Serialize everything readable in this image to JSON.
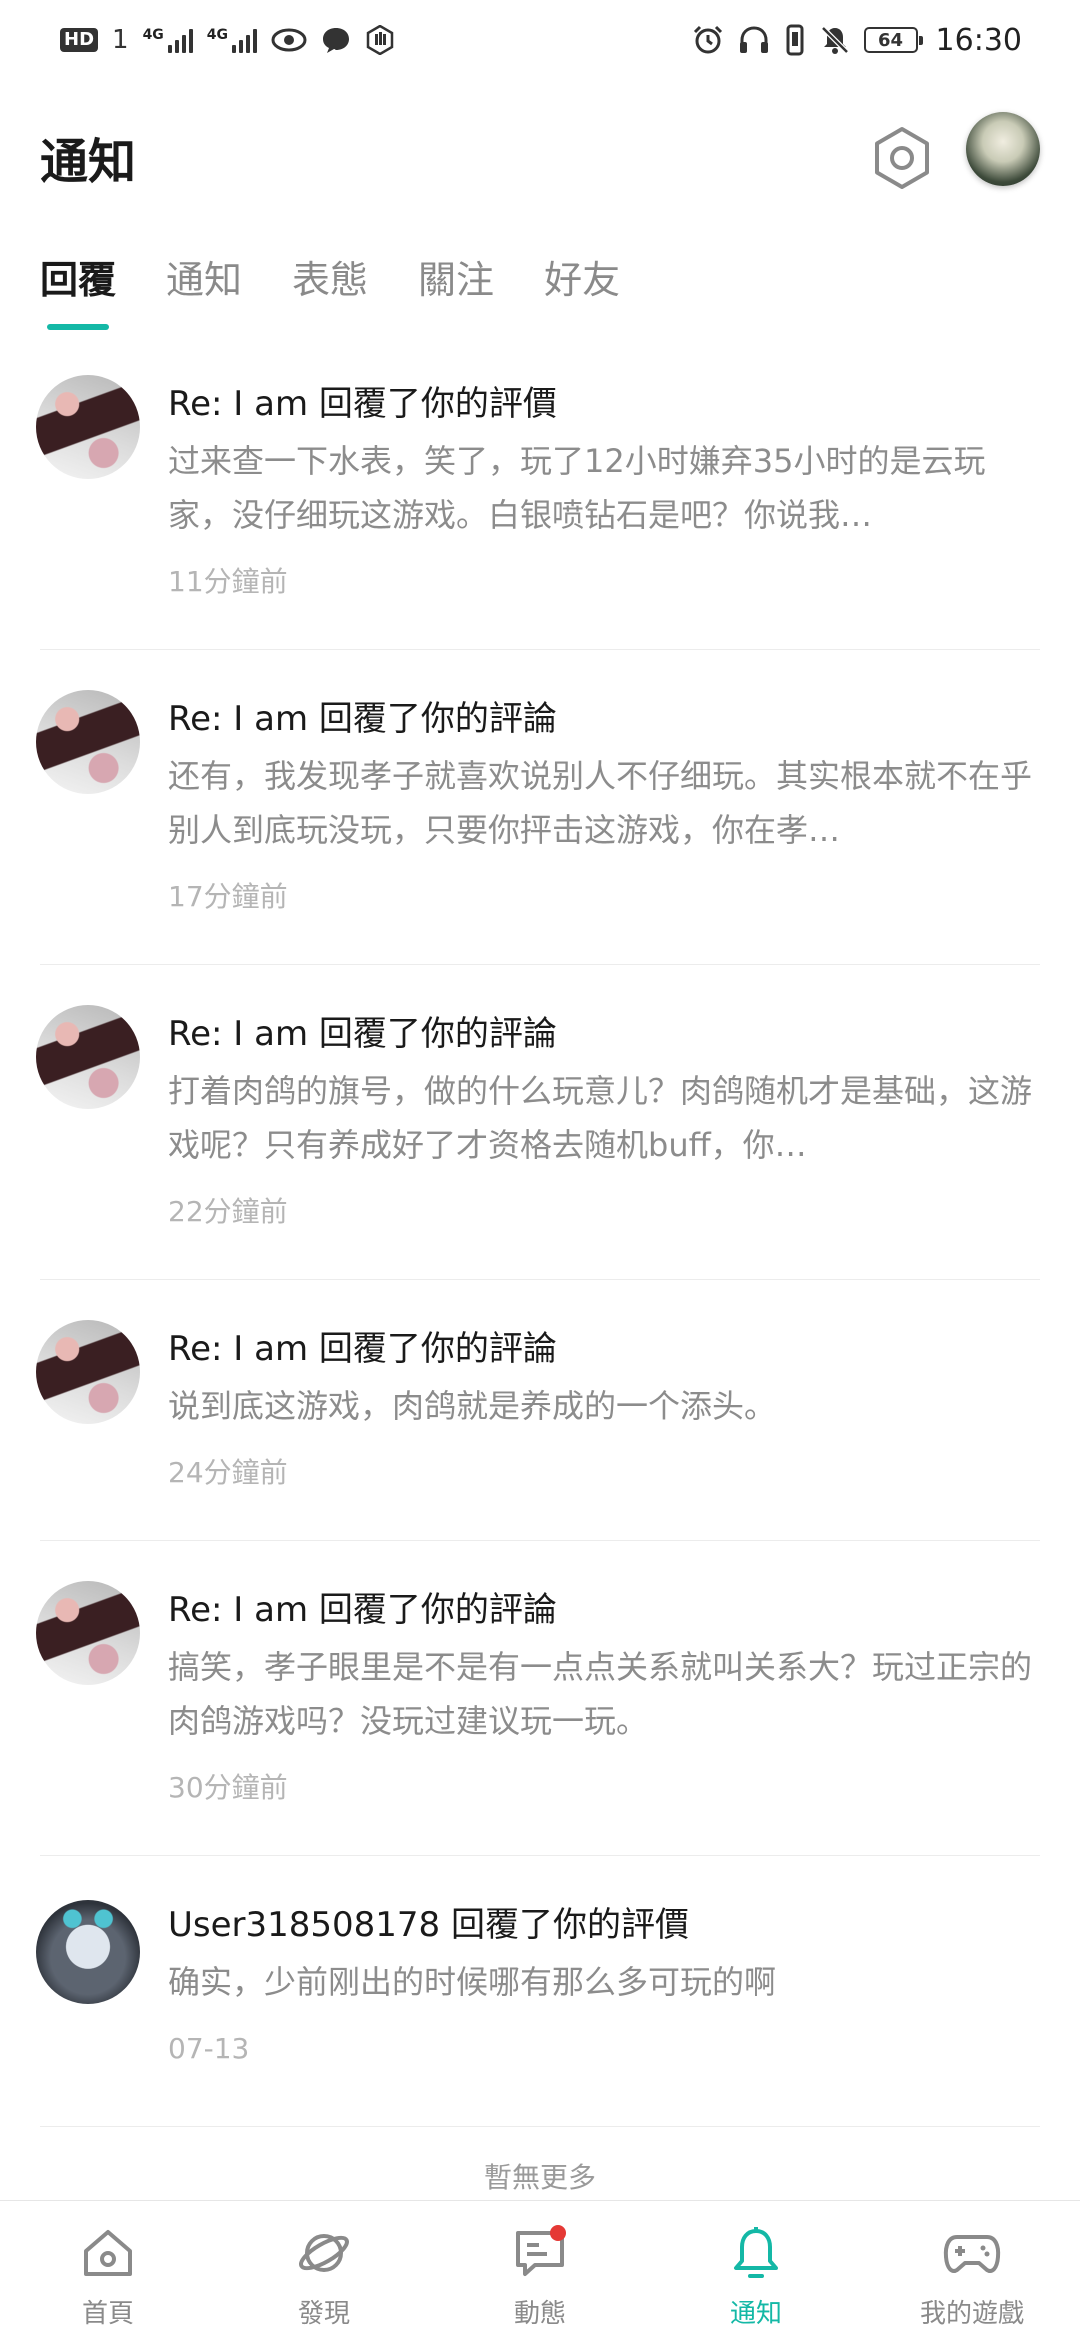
{
  "status_bar": {
    "left_icons": [
      "hd-icon",
      "sim-1-icon",
      "signal-4g-icon",
      "signal-4g-icon",
      "eye-icon",
      "chat-bubble-icon",
      "hand-icon"
    ],
    "right_icons": [
      "alarm-icon",
      "headphones-icon",
      "vibrate-icon",
      "mute-icon"
    ],
    "battery": "64",
    "time": "16:30",
    "labels": {
      "hd": "HD",
      "sim": "1",
      "net": "4G"
    }
  },
  "header": {
    "title": "通知"
  },
  "tabs": [
    {
      "label": "回覆",
      "active": true
    },
    {
      "label": "通知",
      "active": false
    },
    {
      "label": "表態",
      "active": false
    },
    {
      "label": "關注",
      "active": false
    },
    {
      "label": "好友",
      "active": false
    }
  ],
  "notifications": [
    {
      "title": "Re: I am 回覆了你的評價",
      "body": "过来查一下水表，笑了，玩了12小时嫌弃35小时的是云玩家，没仔细玩这游戏。白银喷钻石是吧？你说我…",
      "time": "11分鐘前"
    },
    {
      "title": "Re: I am 回覆了你的評論",
      "body": "还有，我发现孝子就喜欢说别人不仔细玩。其实根本就不在乎别人到底玩没玩，只要你抨击这游戏，你在孝…",
      "time": "17分鐘前"
    },
    {
      "title": "Re: I am 回覆了你的評論",
      "body": "打着肉鸽的旗号，做的什么玩意儿？肉鸽随机才是基础，这游戏呢？只有养成好了才资格去随机buff，你…",
      "time": "22分鐘前"
    },
    {
      "title": "Re: I am 回覆了你的評論",
      "body": "说到底这游戏，肉鸽就是养成的一个添头。",
      "time": "24分鐘前"
    },
    {
      "title": "Re: I am 回覆了你的評論",
      "body": "搞笑，孝子眼里是不是有一点点关系就叫关系大？玩过正宗的肉鸽游戏吗？没玩过建议玩一玩。",
      "time": "30分鐘前"
    },
    {
      "title": "User318508178 回覆了你的評價",
      "body": "确实，少前刚出的时候哪有那么多可玩的啊",
      "time": "07-13"
    }
  ],
  "list_footer": "暫無更多",
  "bottom_nav": [
    {
      "label": "首頁",
      "icon": "home-icon",
      "active": false
    },
    {
      "label": "發現",
      "icon": "planet-icon",
      "active": false
    },
    {
      "label": "動態",
      "icon": "message-icon",
      "active": false,
      "badge": true
    },
    {
      "label": "通知",
      "icon": "bell-icon",
      "active": true
    },
    {
      "label": "我的遊戲",
      "icon": "gamepad-icon",
      "active": false
    }
  ],
  "colors": {
    "accent": "#14b8a6",
    "badge": "#e53935",
    "muted_text": "#8c8c8c"
  }
}
